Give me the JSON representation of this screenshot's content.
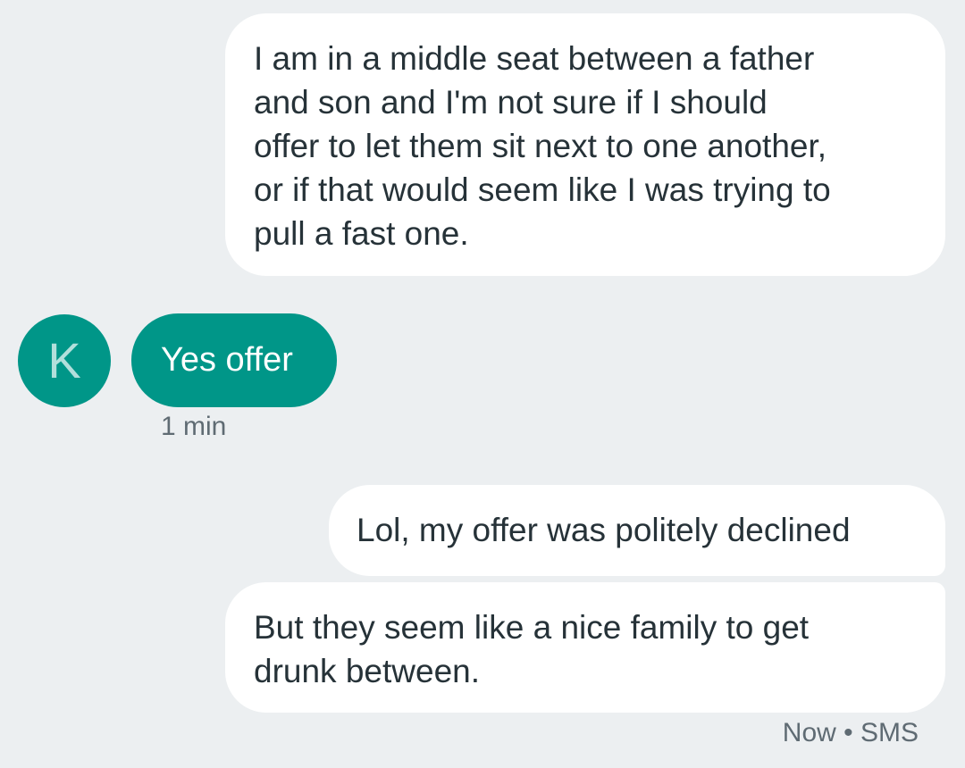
{
  "conversation": {
    "messages": [
      {
        "direction": "outgoing",
        "text": "I am in a middle seat between a father\nand son and I'm not sure if I should\noffer to let them sit next to one another,\nor if that would seem like I was trying to\npull a fast one."
      },
      {
        "direction": "incoming",
        "text": "Yes offer"
      },
      {
        "direction": "outgoing",
        "text": "Lol, my offer was politely declined"
      },
      {
        "direction": "outgoing",
        "text": "But they seem like a nice family to get\ndrunk between."
      }
    ],
    "contact_initial": "K",
    "incoming_timestamp": "1 min",
    "status_text": "Now • SMS"
  },
  "colors": {
    "background": "#eceff1",
    "outgoing_bubble": "#ffffff",
    "incoming_bubble": "#009688",
    "avatar_background": "#009688",
    "avatar_letter": "#b2dfdb",
    "meta_text": "#5f6b73"
  }
}
